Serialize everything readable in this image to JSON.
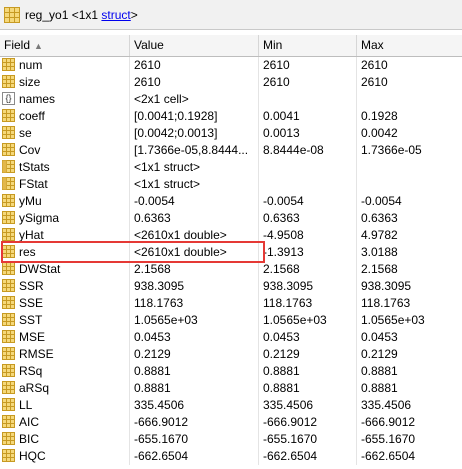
{
  "window": {
    "var_name": "reg_yo1",
    "dims": "<1x1",
    "class_link": "struct",
    "close": ">"
  },
  "columns": {
    "field": "Field",
    "value": "Value",
    "min": "Min",
    "max": "Max"
  },
  "rows": [
    {
      "name": "num",
      "icon": "grid",
      "value": "2610",
      "min": "2610",
      "max": "2610"
    },
    {
      "name": "size",
      "icon": "grid",
      "value": "2610",
      "min": "2610",
      "max": "2610"
    },
    {
      "name": "names",
      "icon": "braces",
      "value": "<2x1 cell>",
      "min": "",
      "max": ""
    },
    {
      "name": "coeff",
      "icon": "grid",
      "value": "[0.0041;0.1928]",
      "min": "0.0041",
      "max": "0.1928"
    },
    {
      "name": "se",
      "icon": "grid",
      "value": "[0.0042;0.0013]",
      "min": "0.0013",
      "max": "0.0042"
    },
    {
      "name": "Cov",
      "icon": "grid",
      "value": "[1.7366e-05,8.8444...",
      "min": "8.8444e-08",
      "max": "1.7366e-05"
    },
    {
      "name": "tStats",
      "icon": "struct",
      "value": "<1x1 struct>",
      "min": "",
      "max": ""
    },
    {
      "name": "FStat",
      "icon": "struct",
      "value": "<1x1 struct>",
      "min": "",
      "max": ""
    },
    {
      "name": "yMu",
      "icon": "grid",
      "value": "-0.0054",
      "min": "-0.0054",
      "max": "-0.0054"
    },
    {
      "name": "ySigma",
      "icon": "grid",
      "value": "0.6363",
      "min": "0.6363",
      "max": "0.6363"
    },
    {
      "name": "yHat",
      "icon": "grid",
      "value": "<2610x1 double>",
      "min": "-4.9508",
      "max": "4.9782"
    },
    {
      "name": "res",
      "icon": "grid",
      "value": "<2610x1 double>",
      "min": "-1.3913",
      "max": "3.0188"
    },
    {
      "name": "DWStat",
      "icon": "grid",
      "value": "2.1568",
      "min": "2.1568",
      "max": "2.1568"
    },
    {
      "name": "SSR",
      "icon": "grid",
      "value": "938.3095",
      "min": "938.3095",
      "max": "938.3095"
    },
    {
      "name": "SSE",
      "icon": "grid",
      "value": "118.1763",
      "min": "118.1763",
      "max": "118.1763"
    },
    {
      "name": "SST",
      "icon": "grid",
      "value": "1.0565e+03",
      "min": "1.0565e+03",
      "max": "1.0565e+03"
    },
    {
      "name": "MSE",
      "icon": "grid",
      "value": "0.0453",
      "min": "0.0453",
      "max": "0.0453"
    },
    {
      "name": "RMSE",
      "icon": "grid",
      "value": "0.2129",
      "min": "0.2129",
      "max": "0.2129"
    },
    {
      "name": "RSq",
      "icon": "grid",
      "value": "0.8881",
      "min": "0.8881",
      "max": "0.8881"
    },
    {
      "name": "aRSq",
      "icon": "grid",
      "value": "0.8881",
      "min": "0.8881",
      "max": "0.8881"
    },
    {
      "name": "LL",
      "icon": "grid",
      "value": "335.4506",
      "min": "335.4506",
      "max": "335.4506"
    },
    {
      "name": "AIC",
      "icon": "grid",
      "value": "-666.9012",
      "min": "-666.9012",
      "max": "-666.9012"
    },
    {
      "name": "BIC",
      "icon": "grid",
      "value": "-655.1670",
      "min": "-655.1670",
      "max": "-655.1670"
    },
    {
      "name": "HQC",
      "icon": "grid",
      "value": "-662.6504",
      "min": "-662.6504",
      "max": "-662.6504"
    }
  ],
  "highlighted_row": "res",
  "colors": {
    "grid_icon_fill": "#f5d87a",
    "grid_icon_line": "#c79a22",
    "struct_icon_fill": "#f5d87a",
    "highlight_border": "#e53935",
    "link": "#0000ee"
  }
}
